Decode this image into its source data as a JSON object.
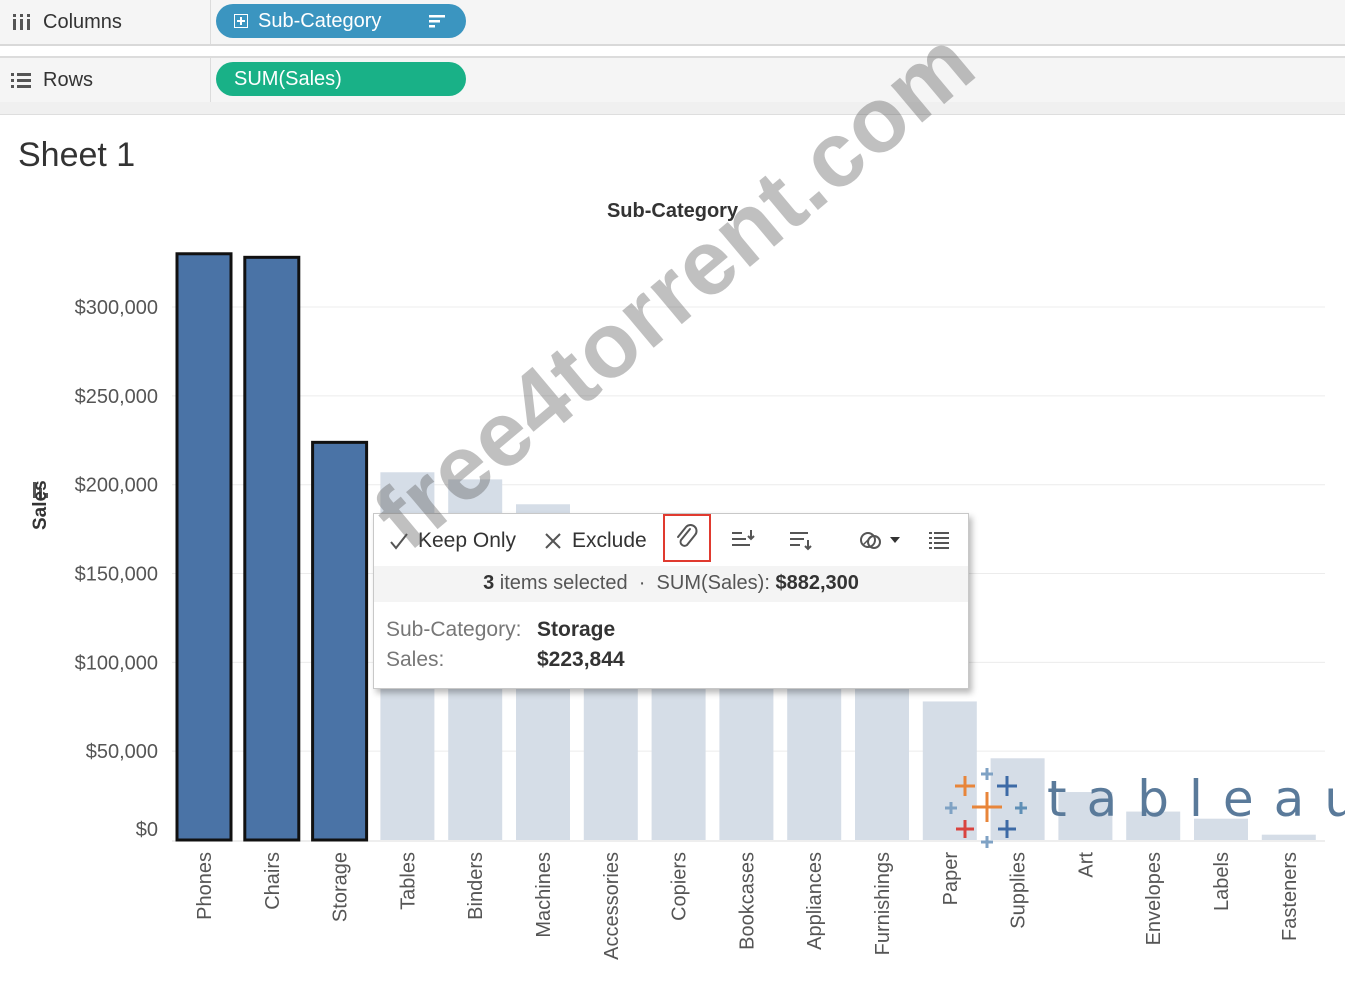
{
  "shelves": {
    "columns": {
      "label": "Columns",
      "pill": "Sub-Category"
    },
    "rows": {
      "label": "Rows",
      "pill": "SUM(Sales)"
    }
  },
  "sheet": {
    "title": "Sheet 1",
    "column_header": "Sub-Category"
  },
  "tooltip": {
    "keep_only_label": "Keep Only",
    "exclude_label": "Exclude",
    "summary_count": "3",
    "summary_items": "items selected",
    "summary_sep": "·",
    "summary_measure": "SUM(Sales):",
    "summary_total": "$882,300",
    "field_label": "Sub-Category:",
    "field_value": "Storage",
    "sales_label": "Sales:",
    "sales_value": "$223,844"
  },
  "overlays": {
    "watermark": "free4torrent.com",
    "logo": "tableau"
  },
  "colors": {
    "selected_bar": "#4a73a6",
    "unselected_bar": "#d5dde7",
    "dimension_pill": "#3b95c0",
    "measure_pill": "#19b187",
    "highlight_box": "#e03a2f"
  },
  "chart_data": {
    "type": "bar",
    "title": "",
    "xlabel": "Sub-Category",
    "ylabel": "Sales",
    "categories": [
      "Phones",
      "Chairs",
      "Storage",
      "Tables",
      "Binders",
      "Machines",
      "Accessories",
      "Copiers",
      "Bookcases",
      "Appliances",
      "Furnishings",
      "Paper",
      "Supplies",
      "Art",
      "Envelopes",
      "Labels",
      "Fasteners"
    ],
    "values": [
      330000,
      328000,
      223844,
      207000,
      203000,
      189000,
      167000,
      150000,
      115000,
      107000,
      92000,
      78000,
      46000,
      27000,
      16000,
      12000,
      3000
    ],
    "selected": [
      "Phones",
      "Chairs",
      "Storage"
    ],
    "ylim": [
      0,
      340000
    ],
    "yticks": [
      0,
      50000,
      100000,
      150000,
      200000,
      250000,
      300000
    ],
    "ytick_labels": [
      "$0",
      "$50,000",
      "$100,000",
      "$150,000",
      "$200,000",
      "$250,000",
      "$300,000"
    ],
    "grid": true,
    "legend": "none"
  }
}
